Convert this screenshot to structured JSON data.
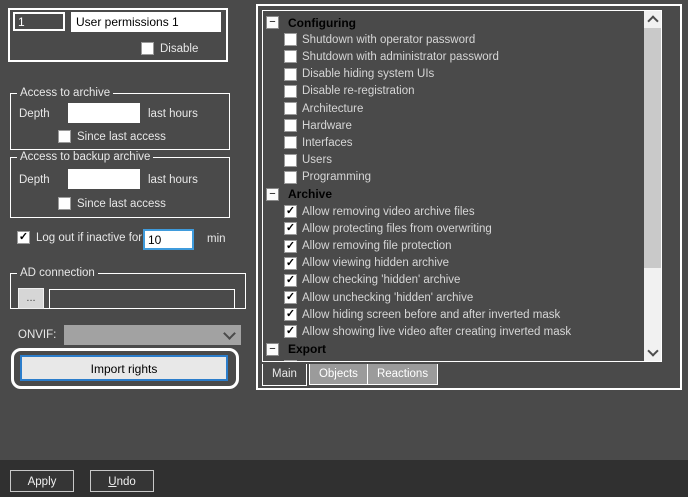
{
  "identity": {
    "id_value": "1",
    "name_value": "User permissions 1",
    "disable_label": "Disable",
    "disable_checked": false
  },
  "archive_access": {
    "title": "Access to archive",
    "depth_label": "Depth",
    "depth_value": "",
    "unit_label": "last hours",
    "since_label": "Since last access",
    "since_checked": false
  },
  "backup_archive_access": {
    "title": "Access to backup archive",
    "depth_label": "Depth",
    "depth_value": "",
    "unit_label": "last hours",
    "since_label": "Since last access",
    "since_checked": false
  },
  "logout": {
    "label": "Log out if inactive for",
    "value": "10",
    "unit": "min",
    "checked": true
  },
  "ad_connection": {
    "title": "AD connection",
    "browse_label": "...",
    "value": ""
  },
  "onvif": {
    "label": "ONVIF:",
    "selected_value": ""
  },
  "import": {
    "label": "Import rights"
  },
  "rights_tree": {
    "sections": [
      {
        "header": "Configuring",
        "expanded": true,
        "items": [
          {
            "label": "Shutdown with operator password",
            "checked": false
          },
          {
            "label": "Shutdown with administrator password",
            "checked": false
          },
          {
            "label": "Disable hiding system UIs",
            "checked": false
          },
          {
            "label": "Disable re-registration",
            "checked": false
          },
          {
            "label": "Architecture",
            "checked": false
          },
          {
            "label": "Hardware",
            "checked": false
          },
          {
            "label": "Interfaces",
            "checked": false
          },
          {
            "label": "Users",
            "checked": false
          },
          {
            "label": "Programming",
            "checked": false
          }
        ]
      },
      {
        "header": "Archive",
        "expanded": true,
        "items": [
          {
            "label": "Allow removing video archive files",
            "checked": true
          },
          {
            "label": "Allow protecting files from overwriting",
            "checked": true
          },
          {
            "label": "Allow removing file protection",
            "checked": true
          },
          {
            "label": "Allow viewing hidden archive",
            "checked": true
          },
          {
            "label": "Allow checking 'hidden' archive",
            "checked": true
          },
          {
            "label": "Allow unchecking 'hidden' archive",
            "checked": true
          },
          {
            "label": "Allow hiding screen before and after inverted mask",
            "checked": true
          },
          {
            "label": "Allow showing live video after creating inverted mask",
            "checked": true
          }
        ]
      },
      {
        "header": "Export",
        "expanded": true,
        "items": []
      }
    ],
    "clipped_next_row": true
  },
  "tabs": {
    "items": [
      "Main",
      "Objects",
      "Reactions"
    ],
    "active": "Main"
  },
  "footer": {
    "apply_label": "Apply",
    "undo_mnemonic": "U",
    "undo_rest": "ndo"
  },
  "colors": {
    "window_bg": "#4a4a4a",
    "footer_bg": "#303030",
    "panel_border": "#ffffff",
    "focus_blue": "#3f9bdc",
    "import_border_blue": "#2b7dcb",
    "tree_item_text": "#d6d6d6",
    "header_text": "#000000"
  }
}
